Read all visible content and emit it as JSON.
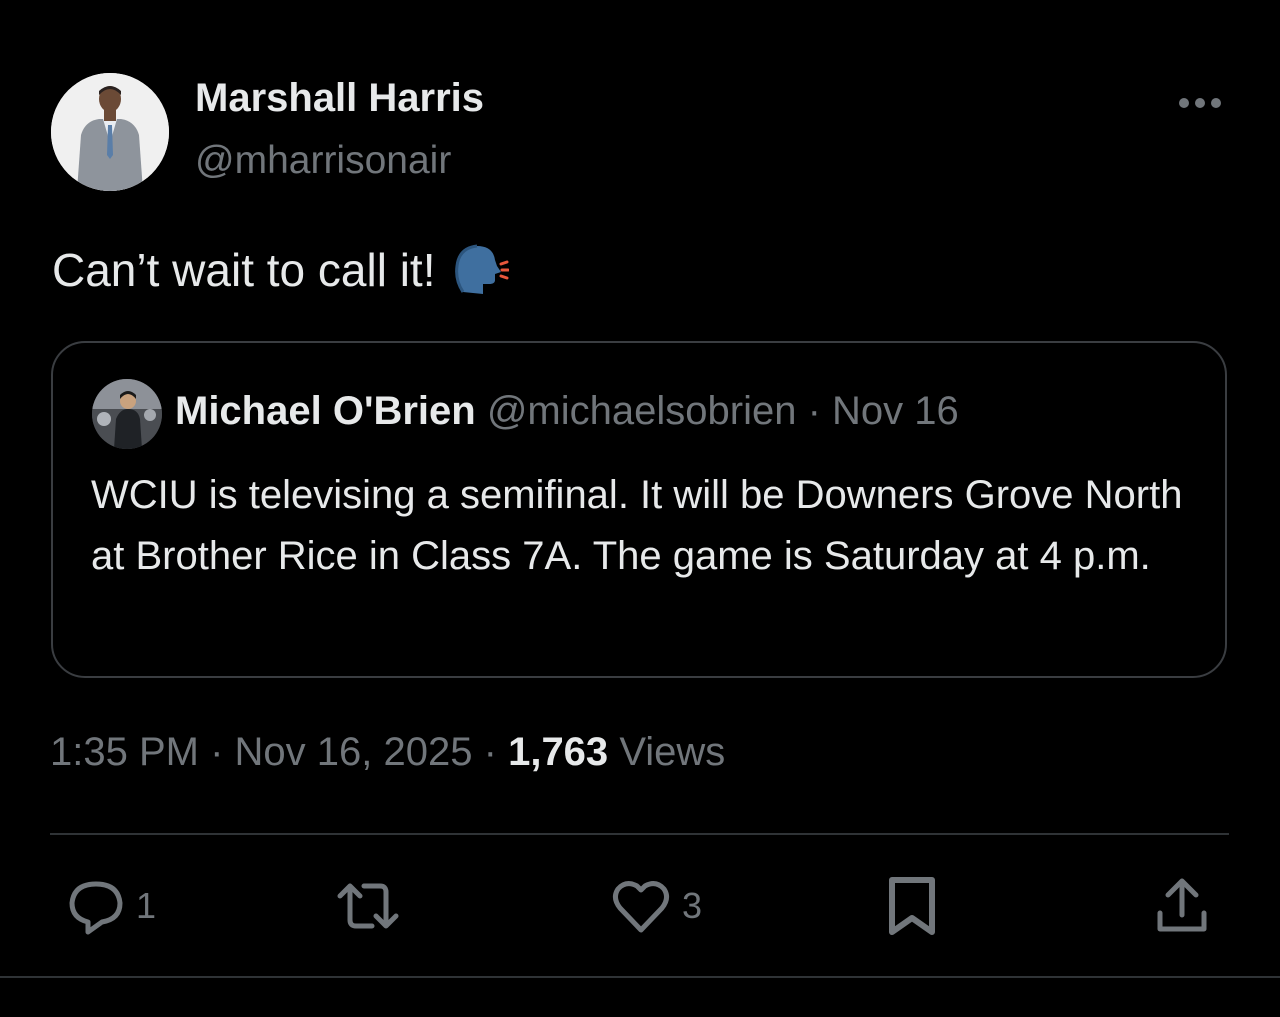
{
  "tweet": {
    "author_name": "Marshall Harris",
    "author_handle": "@mharrisonair",
    "text": "Can’t wait to call it!",
    "text_emoji": "speaking-head-emoji",
    "more_icon": "more-horizontal-icon"
  },
  "quoted": {
    "author_name": "Michael O'Brien",
    "author_handle": "@michaelsobrien",
    "separator": "·",
    "date": "Nov 16",
    "text": "WCIU is televising a semifinal. It will be Downers Grove North at Brother Rice in Class 7A. The game is Saturday at 4 p.m."
  },
  "meta": {
    "time": "1:35 PM",
    "separator": "·",
    "date": "Nov 16, 2025",
    "views_count": "1,763",
    "views_label": "Views"
  },
  "actions": {
    "reply_count": "1",
    "like_count": "3"
  },
  "colors": {
    "background": "#000000",
    "text": "#e7e9ea",
    "secondary": "#71767b",
    "border": "#3a3d41"
  }
}
